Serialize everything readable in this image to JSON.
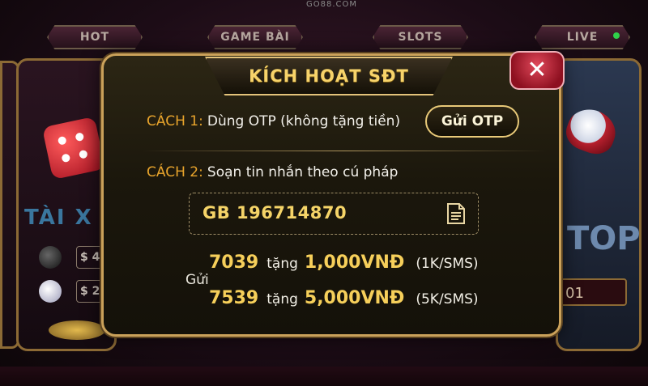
{
  "background": {
    "brand": "GO88.COM",
    "tabs": [
      "HOT",
      "GAME BÀI",
      "SLOTS",
      "LIVE"
    ],
    "left_card": {
      "title": "TÀI X",
      "bets": [
        "$ 4",
        "$ 2"
      ]
    },
    "right_card": {
      "title": "TOP",
      "box_value": "01"
    }
  },
  "modal": {
    "title": "KÍCH HOẠT SĐT",
    "close_label": "✕",
    "option1": {
      "label": "CÁCH 1:",
      "text": "Dùng OTP (không tặng tiền)",
      "button": "Gửi OTP"
    },
    "option2": {
      "label": "CÁCH 2:",
      "text": "Soạn tin nhắn theo cú pháp"
    },
    "sms_syntax": "GB 196714870",
    "send_label": "Gửi",
    "prices": [
      {
        "number": "7039",
        "gift_word": "tặng",
        "amount": "1,000VNĐ",
        "unit": "(1K/SMS)"
      },
      {
        "number": "7539",
        "gift_word": "tặng",
        "amount": "5,000VNĐ",
        "unit": "(5K/SMS)"
      }
    ]
  },
  "colors": {
    "gold": "#f6cf5a",
    "label_orange": "#e9a52c",
    "close_red": "#c72a3a"
  }
}
